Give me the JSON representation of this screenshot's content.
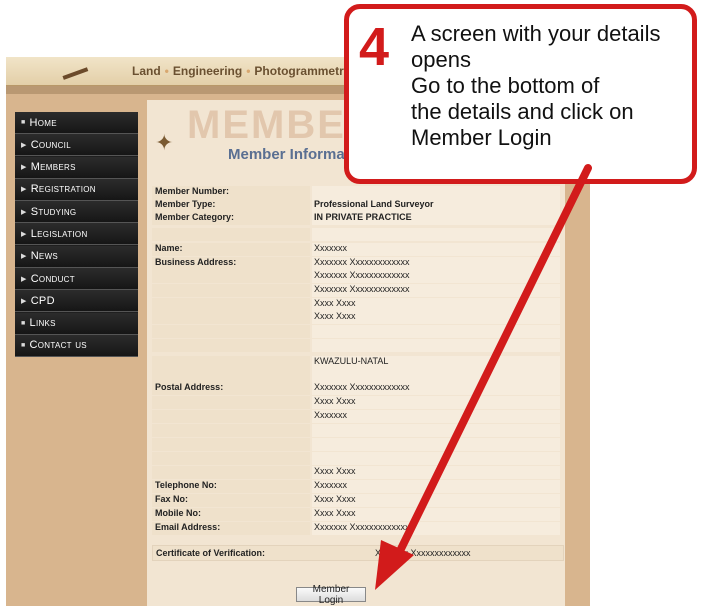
{
  "site": {
    "tagline": [
      "Land",
      "Engineering",
      "Photogrammetr"
    ],
    "header_big": "MEMBER",
    "header_sub": "Member Informatio"
  },
  "nav": [
    {
      "label": "Home",
      "icon": "square-bullet-icon"
    },
    {
      "label": "Council",
      "icon": "triangle-right-icon"
    },
    {
      "label": "Members",
      "icon": "triangle-right-icon"
    },
    {
      "label": "Registration",
      "icon": "triangle-right-icon"
    },
    {
      "label": "Studying",
      "icon": "triangle-right-icon"
    },
    {
      "label": "Legislation",
      "icon": "triangle-right-icon"
    },
    {
      "label": "News",
      "icon": "triangle-right-icon"
    },
    {
      "label": "Conduct",
      "icon": "triangle-right-icon"
    },
    {
      "label": "CPD",
      "icon": "triangle-right-icon"
    },
    {
      "label": "Links",
      "icon": "square-bullet-icon"
    },
    {
      "label": "Contact us",
      "icon": "square-bullet-icon"
    }
  ],
  "details": {
    "member_number": {
      "label": "Member Number:",
      "value": ""
    },
    "member_type": {
      "label": "Member Type:",
      "value": "Professional Land Surveyor"
    },
    "member_category": {
      "label": "Member Category:",
      "value": "IN PRIVATE PRACTICE"
    },
    "name": {
      "label": "Name:",
      "value": "Xxxxxxx"
    },
    "business_address": {
      "label": "Business Address:",
      "lines": [
        "Xxxxxxx  Xxxxxxxxxxxxx",
        "Xxxxxxx  Xxxxxxxxxxxxx",
        "Xxxxxxx  Xxxxxxxxxxxxx",
        "Xxxx Xxxx",
        "Xxxx Xxxx"
      ]
    },
    "province": "KWAZULU-NATAL",
    "postal_address": {
      "label": "Postal Address:",
      "lines": [
        "Xxxxxxx  Xxxxxxxxxxxxx",
        "Xxxx Xxxx",
        "Xxxxxxx"
      ]
    },
    "postal_extra": "Xxxx Xxxx",
    "telephone": {
      "label": "Telephone No:",
      "value": "Xxxxxxx"
    },
    "fax": {
      "label": "Fax No:",
      "value": "Xxxx Xxxx"
    },
    "mobile": {
      "label": "Mobile No:",
      "value": "Xxxx Xxxx"
    },
    "email": {
      "label": "Email Address:",
      "value": "Xxxxxxx  Xxxxxxxxxxxxx"
    },
    "certificate": {
      "label": "Certificate of Verification:",
      "value": "Xxxxxxx  Xxxxxxxxxxxxx"
    }
  },
  "login_button": "Member Login",
  "callout": {
    "step": "4",
    "text": "A screen with your details\nopens\nGo to the bottom of\nthe details and click on\nMember Login",
    "color": "#d21b1b"
  }
}
